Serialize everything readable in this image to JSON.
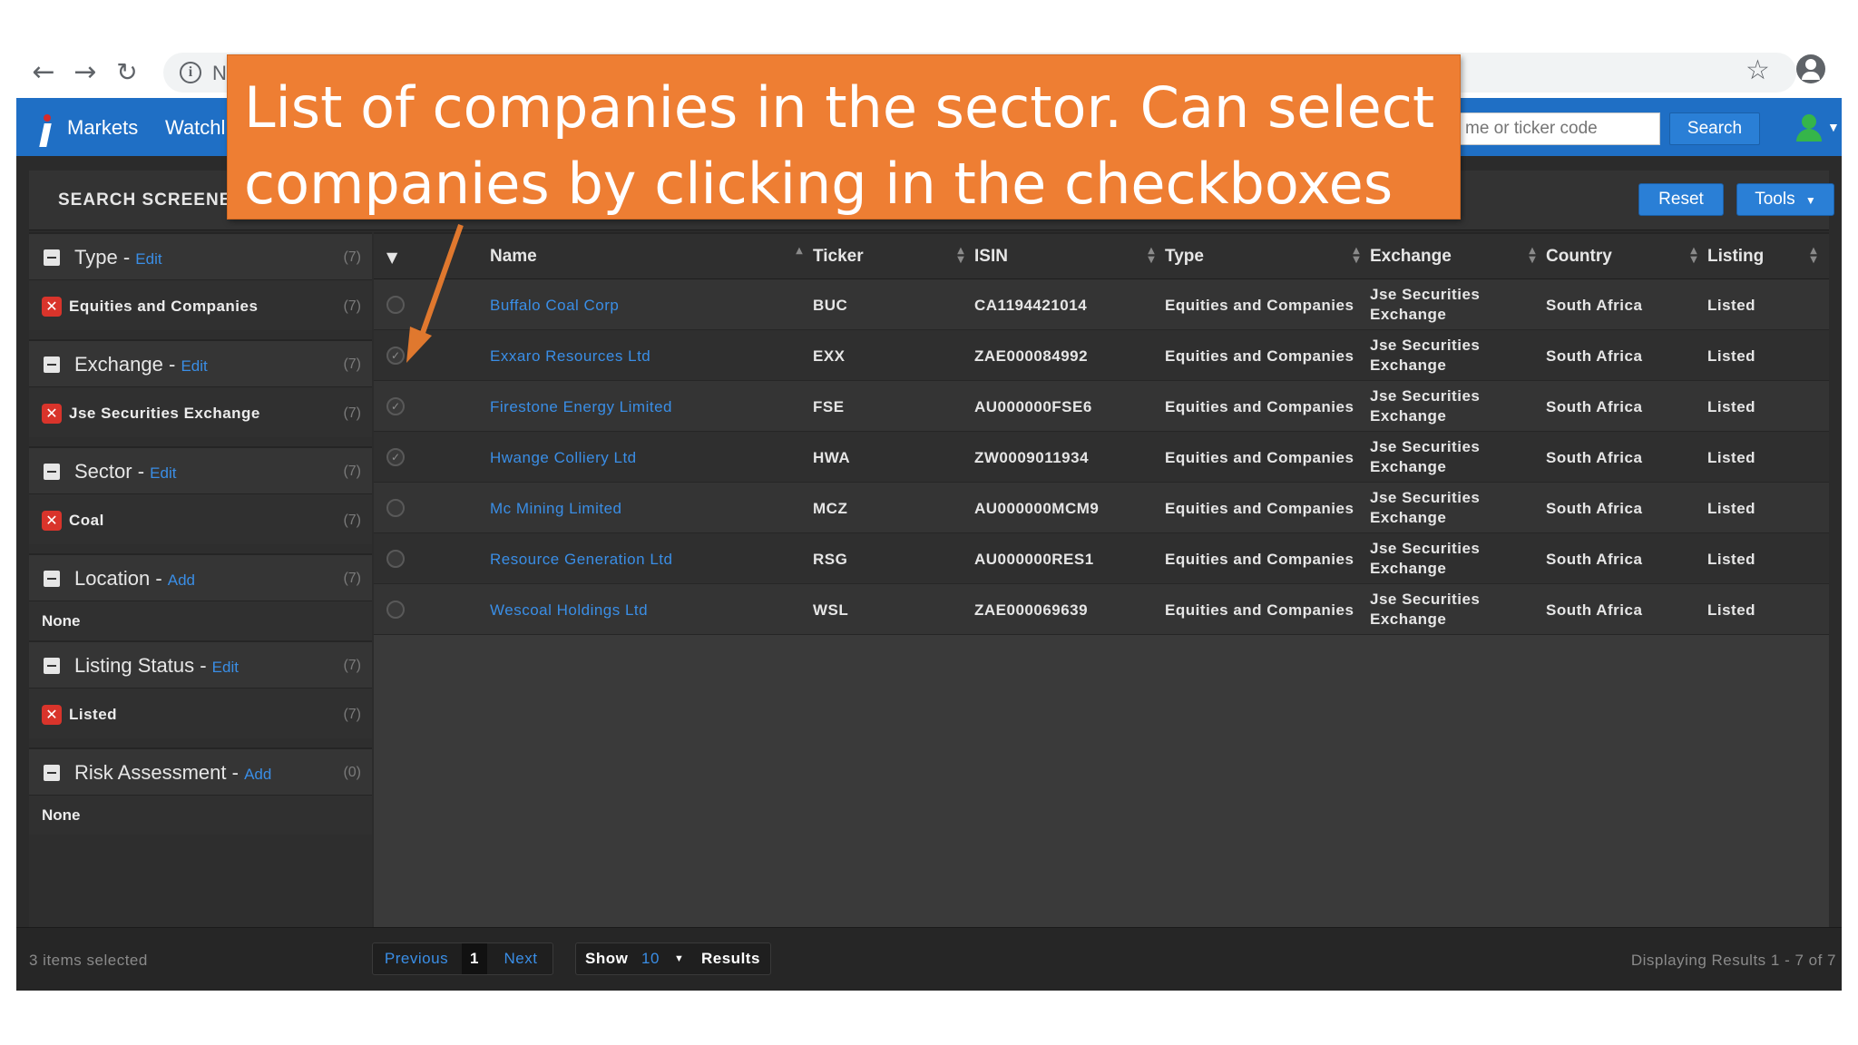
{
  "browser": {
    "address_text": "N"
  },
  "nav": {
    "markets": "Markets",
    "watchlist": "Watchl",
    "search_placeholder": "me or ticker code",
    "search_button": "Search"
  },
  "screener": {
    "title": "SEARCH SCREENEI",
    "reset_button": "Reset",
    "tools_button": "Tools"
  },
  "filters": [
    {
      "label": "Type",
      "action": "Edit",
      "count": "(7)",
      "values": [
        {
          "label": "Equities and Companies",
          "count": "(7)"
        }
      ]
    },
    {
      "label": "Exchange",
      "action": "Edit",
      "count": "(7)",
      "values": [
        {
          "label": "Jse Securities Exchange",
          "count": "(7)"
        }
      ]
    },
    {
      "label": "Sector",
      "action": "Edit",
      "count": "(7)",
      "values": [
        {
          "label": "Coal",
          "count": "(7)"
        }
      ]
    },
    {
      "label": "Location",
      "action": "Add",
      "count": "(7)",
      "none_label": "None"
    },
    {
      "label": "Listing Status",
      "action": "Edit",
      "count": "(7)",
      "values": [
        {
          "label": "Listed",
          "count": "(7)"
        }
      ]
    },
    {
      "label": "Risk Assessment",
      "action": "Add",
      "count": "(0)",
      "none_label": "None"
    }
  ],
  "table": {
    "columns": [
      "Name",
      "Ticker",
      "ISIN",
      "Type",
      "Exchange",
      "Country",
      "Listing"
    ],
    "rows": [
      {
        "checked": false,
        "name": "Buffalo Coal Corp",
        "ticker": "BUC",
        "isin": "CA1194421014",
        "type": "Equities and Companies",
        "exchange_1": "Jse Securities",
        "exchange_2": "Exchange",
        "country": "South Africa",
        "listing": "Listed"
      },
      {
        "checked": true,
        "name": "Exxaro Resources Ltd",
        "ticker": "EXX",
        "isin": "ZAE000084992",
        "type": "Equities and Companies",
        "exchange_1": "Jse Securities",
        "exchange_2": "Exchange",
        "country": "South Africa",
        "listing": "Listed"
      },
      {
        "checked": true,
        "name": "Firestone Energy Limited",
        "ticker": "FSE",
        "isin": "AU000000FSE6",
        "type": "Equities and Companies",
        "exchange_1": "Jse Securities",
        "exchange_2": "Exchange",
        "country": "South Africa",
        "listing": "Listed"
      },
      {
        "checked": true,
        "name": "Hwange Colliery Ltd",
        "ticker": "HWA",
        "isin": "ZW0009011934",
        "type": "Equities and Companies",
        "exchange_1": "Jse Securities",
        "exchange_2": "Exchange",
        "country": "South Africa",
        "listing": "Listed"
      },
      {
        "checked": false,
        "name": "Mc Mining Limited",
        "ticker": "MCZ",
        "isin": "AU000000MCM9",
        "type": "Equities and Companies",
        "exchange_1": "Jse Securities",
        "exchange_2": "Exchange",
        "country": "South Africa",
        "listing": "Listed"
      },
      {
        "checked": false,
        "name": "Resource Generation Ltd",
        "ticker": "RSG",
        "isin": "AU000000RES1",
        "type": "Equities and Companies",
        "exchange_1": "Jse Securities",
        "exchange_2": "Exchange",
        "country": "South Africa",
        "listing": "Listed"
      },
      {
        "checked": false,
        "name": "Wescoal Holdings Ltd",
        "ticker": "WSL",
        "isin": "ZAE000069639",
        "type": "Equities and Companies",
        "exchange_1": "Jse Securities",
        "exchange_2": "Exchange",
        "country": "South Africa",
        "listing": "Listed"
      }
    ]
  },
  "footer": {
    "selected": "3 items selected",
    "previous": "Previous",
    "page": "1",
    "next": "Next",
    "show": "Show",
    "page_size": "10",
    "results": "Results",
    "displaying": "Displaying Results 1 - 7 of 7"
  },
  "annotation": {
    "text": "List of companies in the sector. Can select companies by clicking in the checkboxes"
  },
  "colors": {
    "brand_blue": "#1f6fc5",
    "link_blue": "#3a8ee6",
    "callout_orange": "#ee7e33",
    "remove_red": "#d9342b",
    "user_green": "#35b54a"
  },
  "icons": [
    "back-arrow-icon",
    "forward-arrow-icon",
    "reload-icon",
    "info-icon",
    "star-icon",
    "profile-icon",
    "app-logo-icon",
    "user-icon",
    "minus-icon",
    "remove-x-icon",
    "sort-icon",
    "checkbox-icon",
    "caret-down-icon"
  ]
}
